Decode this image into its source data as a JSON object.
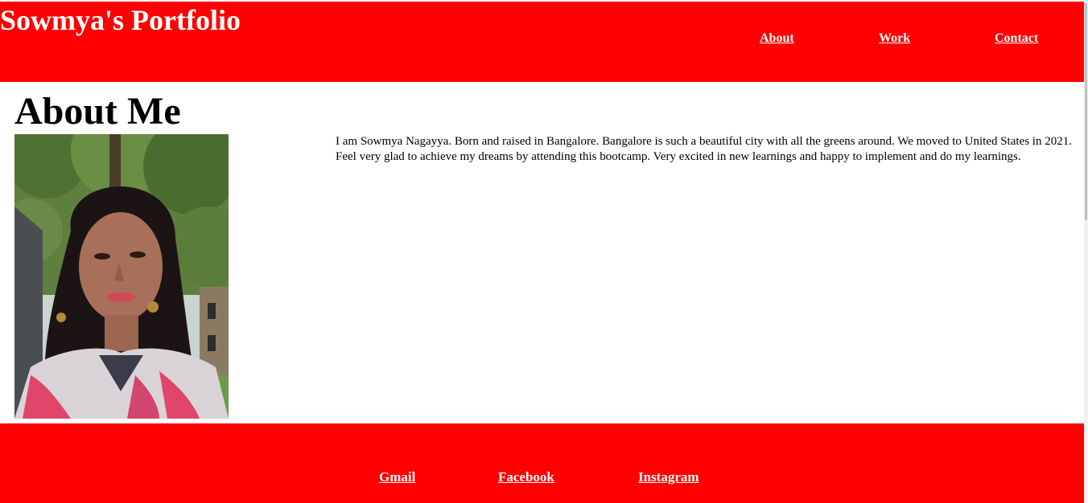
{
  "header": {
    "title": "Sowmya's Portfolio",
    "nav": [
      "About",
      "Work",
      "Contact"
    ]
  },
  "main": {
    "heading": "About Me",
    "photo_alt": "profile-photo",
    "bio": "I am Sowmya Nagayya. Born and raised in Bangalore. Bangalore is such a beautiful city with all the greens around. We moved to United States in 2021. Feel very glad to achieve my dreams by attending this bootcamp. Very excited in new learnings and happy to implement and do my learnings."
  },
  "footer": {
    "links": [
      "Gmail",
      "Facebook",
      "Instagram"
    ]
  },
  "colors": {
    "header_bg": "#ff0000",
    "footer_bg": "#ff0000",
    "link_text": "#ffffff"
  }
}
